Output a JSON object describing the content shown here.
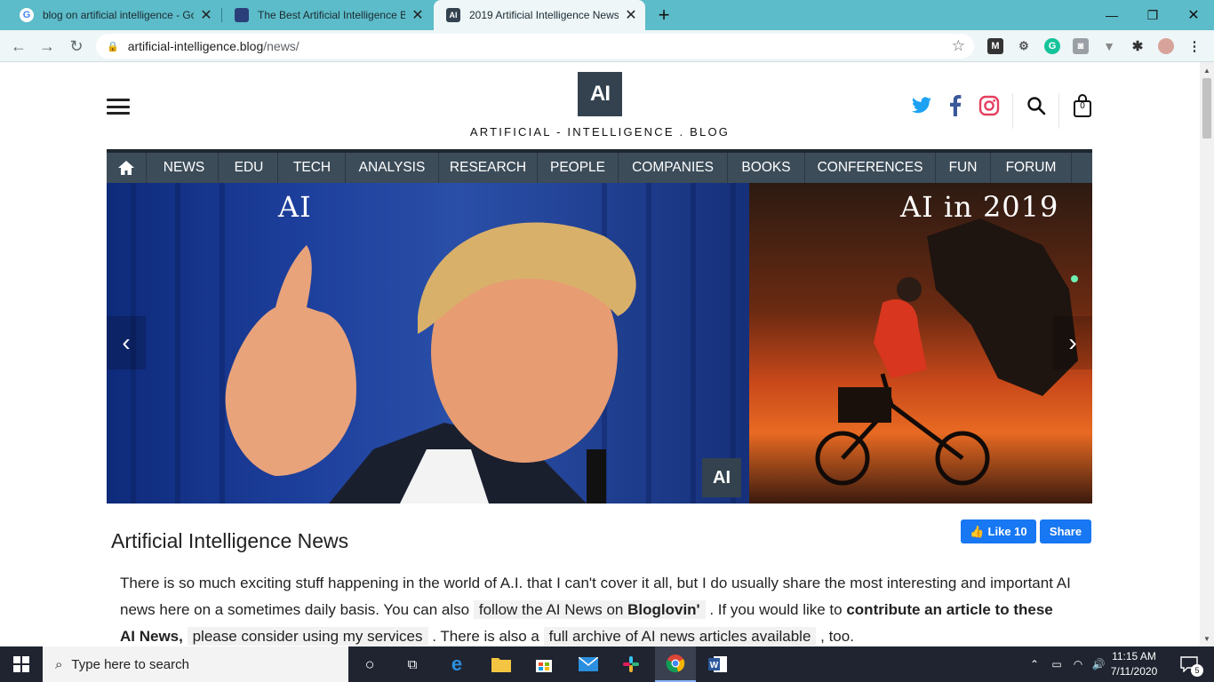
{
  "browser": {
    "tabs": [
      {
        "title": "blog on artificial intelligence - Go",
        "active": false
      },
      {
        "title": "The Best Artificial Intelligence Blo",
        "active": false
      },
      {
        "title": "2019 Artificial Intelligence News",
        "active": true
      }
    ],
    "new_tab_icon": "+",
    "url_host": "artificial-intelligence.blog",
    "url_path": "/news/"
  },
  "site": {
    "logo_text": "AI",
    "name": "ARTIFICIAL - INTELLIGENCE . BLOG",
    "cart_count": "0"
  },
  "nav": {
    "items": [
      "NEWS",
      "EDU",
      "TECH",
      "ANALYSIS",
      "RESEARCH",
      "PEOPLE",
      "COMPANIES",
      "BOOKS",
      "CONFERENCES",
      "FUN",
      "FORUM"
    ]
  },
  "slider": {
    "slide1_title": "AI",
    "slide2_title": "AI in 2019",
    "badge": "AI",
    "prev_arrow": "‹",
    "next_arrow": "›"
  },
  "article": {
    "title": "Artificial Intelligence News",
    "like_label": "Like 10",
    "share_label": "Share",
    "p1": "There is so much exciting stuff happening in the world of A.I. that I can't cover it all, but I do usually share the most interesting and important AI news here on a sometimes daily basis. You can also ",
    "link1_prefix": "follow the AI News on ",
    "link1_bold": "Bloglovin'",
    "p2": " . If you would like to ",
    "bold1": "contribute an article to these AI News,",
    "link2": "please consider using my services",
    "p3": " . There is also a ",
    "link3": "full archive of AI news articles available",
    "p4": " , too."
  },
  "taskbar": {
    "search_placeholder": "Type here to search",
    "time": "11:15 AM",
    "date": "7/11/2020",
    "notifications": "5"
  },
  "colors": {
    "tab_strip": "#5cbcc9",
    "nav_bg": "#3c4c59",
    "facebook": "#1877f2",
    "twitter": "#1da1f2",
    "instagram": "#e4405f"
  }
}
